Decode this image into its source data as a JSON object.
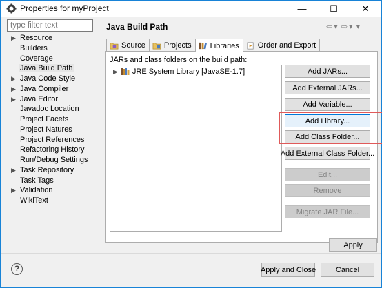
{
  "window": {
    "title": "Properties for myProject",
    "minimize_glyph": "—",
    "maximize_glyph": "☐",
    "close_glyph": "✕"
  },
  "filter": {
    "placeholder": "type filter text"
  },
  "tree": {
    "items": [
      {
        "label": "Resource",
        "expandable": true
      },
      {
        "label": "Builders",
        "expandable": false
      },
      {
        "label": "Coverage",
        "expandable": false
      },
      {
        "label": "Java Build Path",
        "expandable": false,
        "selected": true
      },
      {
        "label": "Java Code Style",
        "expandable": true
      },
      {
        "label": "Java Compiler",
        "expandable": true
      },
      {
        "label": "Java Editor",
        "expandable": true
      },
      {
        "label": "Javadoc Location",
        "expandable": false
      },
      {
        "label": "Project Facets",
        "expandable": false
      },
      {
        "label": "Project Natures",
        "expandable": false
      },
      {
        "label": "Project References",
        "expandable": false
      },
      {
        "label": "Refactoring History",
        "expandable": false
      },
      {
        "label": "Run/Debug Settings",
        "expandable": false
      },
      {
        "label": "Task Repository",
        "expandable": true
      },
      {
        "label": "Task Tags",
        "expandable": false
      },
      {
        "label": "Validation",
        "expandable": true
      },
      {
        "label": "WikiText",
        "expandable": false
      }
    ]
  },
  "page": {
    "title": "Java Build Path",
    "nav_back": "⇦",
    "nav_forward": "⇨",
    "nav_dropdown": "▾",
    "nav_menu": "▾"
  },
  "tabs": [
    {
      "label": "Source",
      "icon": "source-folder-icon",
      "active": false
    },
    {
      "label": "Projects",
      "icon": "projects-icon",
      "active": false
    },
    {
      "label": "Libraries",
      "icon": "libraries-icon",
      "active": true
    },
    {
      "label": "Order and Export",
      "icon": "order-export-icon",
      "active": false
    }
  ],
  "libraries": {
    "caption": "JARs and class folders on the build path:",
    "entries": [
      {
        "label": "JRE System Library [JavaSE-1.7]",
        "icon": "jre-library-icon"
      }
    ]
  },
  "buttons": {
    "add_jars": "Add JARs...",
    "add_external_jars": "Add External JARs...",
    "add_variable": "Add Variable...",
    "add_library": "Add Library...",
    "add_class_folder": "Add Class Folder...",
    "add_external_class_folder": "Add External Class Folder...",
    "edit": "Edit...",
    "remove": "Remove",
    "migrate_jar": "Migrate JAR File...",
    "apply": "Apply"
  },
  "footer": {
    "help_glyph": "?",
    "apply_and_close": "Apply and Close",
    "cancel": "Cancel"
  },
  "colors": {
    "accent": "#0078d7",
    "highlight_outline": "#e05a5a",
    "window_border": "#1883d7"
  }
}
